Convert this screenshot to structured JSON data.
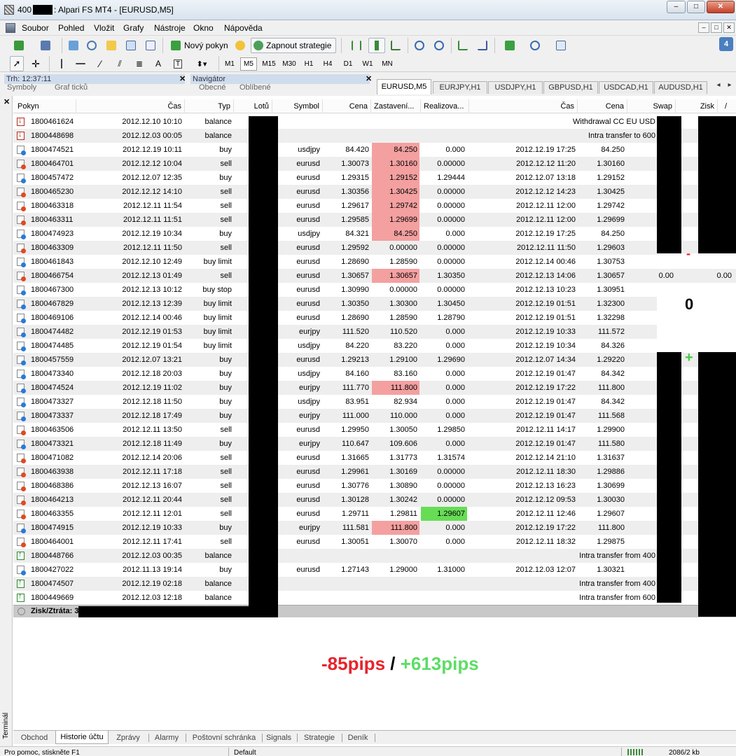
{
  "window": {
    "title_prefix": "400",
    "title_suffix": ": Alpari FS MT4 - [EURUSD,M5]",
    "btn_minimize": "–",
    "btn_maximize": "□",
    "btn_close": "✕"
  },
  "menu": {
    "items": [
      "Soubor",
      "Pohled",
      "Vložit",
      "Grafy",
      "Nástroje",
      "Okno",
      "Nápověda"
    ]
  },
  "toolbar": {
    "new_order_label": "Nový pokyn",
    "strategies_label": "Zapnout strategie",
    "notify_badge": "4",
    "draw_text_tool": "A",
    "draw_label_tool": "T",
    "timeframes": [
      "M1",
      "M5",
      "M15",
      "M30",
      "H1",
      "H4",
      "D1",
      "W1",
      "MN"
    ],
    "active_timeframe": "M5"
  },
  "panels": {
    "market_watch_head": "Trh: 12:37:11",
    "market_watch_ghost_tabs": [
      "Symboly",
      "Graf ticků"
    ],
    "navigator_head": "Navigátor",
    "navigator_ghost_tabs": [
      "Obecné",
      "Oblíbené"
    ],
    "close_glyph": "✕"
  },
  "chart_tabs": [
    "EURUSD,M5",
    "EURJPY,H1",
    "USDJPY,H1",
    "GBPUSD,H1",
    "USDCAD,H1",
    "AUDUSD,H1"
  ],
  "chart_tab_prev": "◂",
  "chart_tab_next": "▸",
  "history": {
    "columns": [
      "Pokyn",
      "Čas",
      "Typ",
      "Lotů",
      "Symbol",
      "Cena",
      "Zastavení...",
      "Realizova...",
      "Čas",
      "Cena",
      "Swap",
      "Zisk"
    ],
    "sort_glyph": "/",
    "rows": [
      {
        "icon": "bal-out",
        "id": "1800461624",
        "time": "2012.12.10 10:10",
        "type": "balance",
        "symbol": "",
        "price": "",
        "sl": "",
        "tp": "",
        "ctime": "",
        "cprice": "",
        "comment": "Withdrawal CC EU USD",
        "hl_sl": "",
        "hl_tp": ""
      },
      {
        "icon": "bal-out",
        "id": "1800448698",
        "time": "2012.12.03 00:05",
        "type": "balance",
        "symbol": "",
        "price": "",
        "sl": "",
        "tp": "",
        "ctime": "",
        "cprice": "",
        "comment": "Intra transfer to 600",
        "hl_sl": "",
        "hl_tp": ""
      },
      {
        "icon": "buy",
        "id": "1800474521",
        "time": "2012.12.19 10:11",
        "type": "buy",
        "symbol": "usdjpy",
        "price": "84.420",
        "sl": "84.250",
        "tp": "0.000",
        "ctime": "2012.12.19 17:25",
        "cprice": "84.250",
        "comment": "",
        "hl_sl": "red",
        "hl_tp": ""
      },
      {
        "icon": "sell",
        "id": "1800464701",
        "time": "2012.12.12 10:04",
        "type": "sell",
        "symbol": "eurusd",
        "price": "1.30073",
        "sl": "1.30160",
        "tp": "0.00000",
        "ctime": "2012.12.12 11:20",
        "cprice": "1.30160",
        "comment": "",
        "hl_sl": "red",
        "hl_tp": ""
      },
      {
        "icon": "buy",
        "id": "1800457472",
        "time": "2012.12.07 12:35",
        "type": "buy",
        "symbol": "eurusd",
        "price": "1.29315",
        "sl": "1.29152",
        "tp": "1.29444",
        "ctime": "2012.12.07 13:18",
        "cprice": "1.29152",
        "comment": "",
        "hl_sl": "red",
        "hl_tp": ""
      },
      {
        "icon": "sell",
        "id": "1800465230",
        "time": "2012.12.12 14:10",
        "type": "sell",
        "symbol": "eurusd",
        "price": "1.30356",
        "sl": "1.30425",
        "tp": "0.00000",
        "ctime": "2012.12.12 14:23",
        "cprice": "1.30425",
        "comment": "",
        "hl_sl": "red",
        "hl_tp": ""
      },
      {
        "icon": "sell",
        "id": "1800463318",
        "time": "2012.12.11 11:54",
        "type": "sell",
        "symbol": "eurusd",
        "price": "1.29617",
        "sl": "1.29742",
        "tp": "0.00000",
        "ctime": "2012.12.11 12:00",
        "cprice": "1.29742",
        "comment": "",
        "hl_sl": "red",
        "hl_tp": ""
      },
      {
        "icon": "sell",
        "id": "1800463311",
        "time": "2012.12.11 11:51",
        "type": "sell",
        "symbol": "eurusd",
        "price": "1.29585",
        "sl": "1.29699",
        "tp": "0.00000",
        "ctime": "2012.12.11 12:00",
        "cprice": "1.29699",
        "comment": "",
        "hl_sl": "red",
        "hl_tp": ""
      },
      {
        "icon": "buy",
        "id": "1800474923",
        "time": "2012.12.19 10:34",
        "type": "buy",
        "symbol": "usdjpy",
        "price": "84.321",
        "sl": "84.250",
        "tp": "0.000",
        "ctime": "2012.12.19 17:25",
        "cprice": "84.250",
        "comment": "",
        "hl_sl": "red",
        "hl_tp": ""
      },
      {
        "icon": "sell",
        "id": "1800463309",
        "time": "2012.12.11 11:50",
        "type": "sell",
        "symbol": "eurusd",
        "price": "1.29592",
        "sl": "0.00000",
        "tp": "0.00000",
        "ctime": "2012.12.11 11:50",
        "cprice": "1.29603",
        "comment": "",
        "hl_sl": "",
        "hl_tp": ""
      },
      {
        "icon": "buy",
        "id": "1800461843",
        "time": "2012.12.10 12:49",
        "type": "buy limit",
        "symbol": "eurusd",
        "price": "1.28690",
        "sl": "1.28590",
        "tp": "0.00000",
        "ctime": "2012.12.14 00:46",
        "cprice": "1.30753",
        "comment": "",
        "hl_sl": "",
        "hl_tp": ""
      },
      {
        "icon": "sell",
        "id": "1800466754",
        "time": "2012.12.13 01:49",
        "type": "sell",
        "symbol": "eurusd",
        "price": "1.30657",
        "sl": "1.30657",
        "tp": "1.30350",
        "ctime": "2012.12.13 14:06",
        "cprice": "1.30657",
        "comment": "",
        "hl_sl": "red",
        "hl_tp": "",
        "swap": "0.00",
        "profit": "0.00"
      },
      {
        "icon": "buy",
        "id": "1800467300",
        "time": "2012.12.13 10:12",
        "type": "buy stop",
        "symbol": "eurusd",
        "price": "1.30990",
        "sl": "0.00000",
        "tp": "0.00000",
        "ctime": "2012.12.13 10:23",
        "cprice": "1.30951",
        "comment": "",
        "hl_sl": "",
        "hl_tp": ""
      },
      {
        "icon": "buy",
        "id": "1800467829",
        "time": "2012.12.13 12:39",
        "type": "buy limit",
        "symbol": "eurusd",
        "price": "1.30350",
        "sl": "1.30300",
        "tp": "1.30450",
        "ctime": "2012.12.19 01:51",
        "cprice": "1.32300",
        "comment": "",
        "hl_sl": "",
        "hl_tp": ""
      },
      {
        "icon": "buy",
        "id": "1800469106",
        "time": "2012.12.14 00:46",
        "type": "buy limit",
        "symbol": "eurusd",
        "price": "1.28690",
        "sl": "1.28590",
        "tp": "1.28790",
        "ctime": "2012.12.19 01:51",
        "cprice": "1.32298",
        "comment": "",
        "hl_sl": "",
        "hl_tp": ""
      },
      {
        "icon": "buy",
        "id": "1800474482",
        "time": "2012.12.19 01:53",
        "type": "buy limit",
        "symbol": "eurjpy",
        "price": "111.520",
        "sl": "110.520",
        "tp": "0.000",
        "ctime": "2012.12.19 10:33",
        "cprice": "111.572",
        "comment": "",
        "hl_sl": "",
        "hl_tp": ""
      },
      {
        "icon": "buy",
        "id": "1800474485",
        "time": "2012.12.19 01:54",
        "type": "buy limit",
        "symbol": "usdjpy",
        "price": "84.220",
        "sl": "83.220",
        "tp": "0.000",
        "ctime": "2012.12.19 10:34",
        "cprice": "84.326",
        "comment": "",
        "hl_sl": "",
        "hl_tp": ""
      },
      {
        "icon": "buy",
        "id": "1800457559",
        "time": "2012.12.07 13:21",
        "type": "buy",
        "symbol": "eurusd",
        "price": "1.29213",
        "sl": "1.29100",
        "tp": "1.29690",
        "ctime": "2012.12.07 14:34",
        "cprice": "1.29220",
        "comment": "",
        "hl_sl": "",
        "hl_tp": ""
      },
      {
        "icon": "buy",
        "id": "1800473340",
        "time": "2012.12.18 20:03",
        "type": "buy",
        "symbol": "usdjpy",
        "price": "84.160",
        "sl": "83.160",
        "tp": "0.000",
        "ctime": "2012.12.19 01:47",
        "cprice": "84.342",
        "comment": "",
        "hl_sl": "",
        "hl_tp": ""
      },
      {
        "icon": "buy",
        "id": "1800474524",
        "time": "2012.12.19 11:02",
        "type": "buy",
        "symbol": "eurjpy",
        "price": "111.770",
        "sl": "111.800",
        "tp": "0.000",
        "ctime": "2012.12.19 17:22",
        "cprice": "111.800",
        "comment": "",
        "hl_sl": "red",
        "hl_tp": ""
      },
      {
        "icon": "buy",
        "id": "1800473327",
        "time": "2012.12.18 11:50",
        "type": "buy",
        "symbol": "usdjpy",
        "price": "83.951",
        "sl": "82.934",
        "tp": "0.000",
        "ctime": "2012.12.19 01:47",
        "cprice": "84.342",
        "comment": "",
        "hl_sl": "",
        "hl_tp": ""
      },
      {
        "icon": "buy",
        "id": "1800473337",
        "time": "2012.12.18 17:49",
        "type": "buy",
        "symbol": "eurjpy",
        "price": "111.000",
        "sl": "110.000",
        "tp": "0.000",
        "ctime": "2012.12.19 01:47",
        "cprice": "111.568",
        "comment": "",
        "hl_sl": "",
        "hl_tp": ""
      },
      {
        "icon": "sell",
        "id": "1800463506",
        "time": "2012.12.11 13:50",
        "type": "sell",
        "symbol": "eurusd",
        "price": "1.29950",
        "sl": "1.30050",
        "tp": "1.29850",
        "ctime": "2012.12.11 14:17",
        "cprice": "1.29900",
        "comment": "",
        "hl_sl": "",
        "hl_tp": ""
      },
      {
        "icon": "buy",
        "id": "1800473321",
        "time": "2012.12.18 11:49",
        "type": "buy",
        "symbol": "eurjpy",
        "price": "110.647",
        "sl": "109.606",
        "tp": "0.000",
        "ctime": "2012.12.19 01:47",
        "cprice": "111.580",
        "comment": "",
        "hl_sl": "",
        "hl_tp": ""
      },
      {
        "icon": "sell",
        "id": "1800471082",
        "time": "2012.12.14 20:06",
        "type": "sell",
        "symbol": "eurusd",
        "price": "1.31665",
        "sl": "1.31773",
        "tp": "1.31574",
        "ctime": "2012.12.14 21:10",
        "cprice": "1.31637",
        "comment": "",
        "hl_sl": "",
        "hl_tp": ""
      },
      {
        "icon": "sell",
        "id": "1800463938",
        "time": "2012.12.11 17:18",
        "type": "sell",
        "symbol": "eurusd",
        "price": "1.29961",
        "sl": "1.30169",
        "tp": "0.00000",
        "ctime": "2012.12.11 18:30",
        "cprice": "1.29886",
        "comment": "",
        "hl_sl": "",
        "hl_tp": ""
      },
      {
        "icon": "sell",
        "id": "1800468386",
        "time": "2012.12.13 16:07",
        "type": "sell",
        "symbol": "eurusd",
        "price": "1.30776",
        "sl": "1.30890",
        "tp": "0.00000",
        "ctime": "2012.12.13 16:23",
        "cprice": "1.30699",
        "comment": "",
        "hl_sl": "",
        "hl_tp": ""
      },
      {
        "icon": "sell",
        "id": "1800464213",
        "time": "2012.12.11 20:44",
        "type": "sell",
        "symbol": "eurusd",
        "price": "1.30128",
        "sl": "1.30242",
        "tp": "0.00000",
        "ctime": "2012.12.12 09:53",
        "cprice": "1.30030",
        "comment": "",
        "hl_sl": "",
        "hl_tp": ""
      },
      {
        "icon": "sell",
        "id": "1800463355",
        "time": "2012.12.11 12:01",
        "type": "sell",
        "symbol": "eurusd",
        "price": "1.29711",
        "sl": "1.29811",
        "tp": "1.29607",
        "ctime": "2012.12.11 12:46",
        "cprice": "1.29607",
        "comment": "",
        "hl_sl": "",
        "hl_tp": "green"
      },
      {
        "icon": "buy",
        "id": "1800474915",
        "time": "2012.12.19 10:33",
        "type": "buy",
        "symbol": "eurjpy",
        "price": "111.581",
        "sl": "111.800",
        "tp": "0.000",
        "ctime": "2012.12.19 17:22",
        "cprice": "111.800",
        "comment": "",
        "hl_sl": "red",
        "hl_tp": ""
      },
      {
        "icon": "sell",
        "id": "1800464001",
        "time": "2012.12.11 17:41",
        "type": "sell",
        "symbol": "eurusd",
        "price": "1.30051",
        "sl": "1.30070",
        "tp": "0.000",
        "ctime": "2012.12.11 18:32",
        "cprice": "1.29875",
        "comment": "",
        "hl_sl": "",
        "hl_tp": ""
      },
      {
        "icon": "bal-in",
        "id": "1800448766",
        "time": "2012.12.03 00:35",
        "type": "balance",
        "symbol": "",
        "price": "",
        "sl": "",
        "tp": "",
        "ctime": "",
        "cprice": "",
        "comment": "Intra transfer from 400",
        "hl_sl": "",
        "hl_tp": ""
      },
      {
        "icon": "buy",
        "id": "1800427022",
        "time": "2012.11.13 19:14",
        "type": "buy",
        "symbol": "eurusd",
        "price": "1.27143",
        "sl": "1.29000",
        "tp": "1.31000",
        "ctime": "2012.12.03 12:07",
        "cprice": "1.30321",
        "comment": "",
        "hl_sl": "",
        "hl_tp": ""
      },
      {
        "icon": "bal-in",
        "id": "1800474507",
        "time": "2012.12.19 02:18",
        "type": "balance",
        "symbol": "",
        "price": "",
        "sl": "",
        "tp": "",
        "ctime": "",
        "cprice": "",
        "comment": "Intra transfer from 400",
        "hl_sl": "",
        "hl_tp": ""
      },
      {
        "icon": "bal-in",
        "id": "1800449669",
        "time": "2012.12.03 12:18",
        "type": "balance",
        "symbol": "",
        "price": "",
        "sl": "",
        "tp": "",
        "ctime": "",
        "cprice": "",
        "comment": "Intra transfer from 600",
        "hl_sl": "",
        "hl_tp": ""
      }
    ],
    "totals_label": "Zisk/Ztráta: 3"
  },
  "annotations": {
    "minus": "-",
    "zero": "0",
    "plus": "+",
    "neg_color": "#e8222a",
    "pos_color": "#5ddd66"
  },
  "summary": {
    "negative": "-85pips",
    "separator": " / ",
    "positive": "+613pips"
  },
  "terminal": {
    "close_glyph": "✕",
    "side_label": "Terminál",
    "tabs": [
      "Obchod",
      "Historie účtu",
      "Zprávy",
      "Alarmy",
      "Poštovní schránka",
      "Signals",
      "Strategie",
      "Deník"
    ],
    "active_tab": "Historie účtu"
  },
  "statusbar": {
    "help_text": "Pro pomoc, stiskněte F1",
    "profile": "Default",
    "traffic": "2086/2 kb"
  }
}
